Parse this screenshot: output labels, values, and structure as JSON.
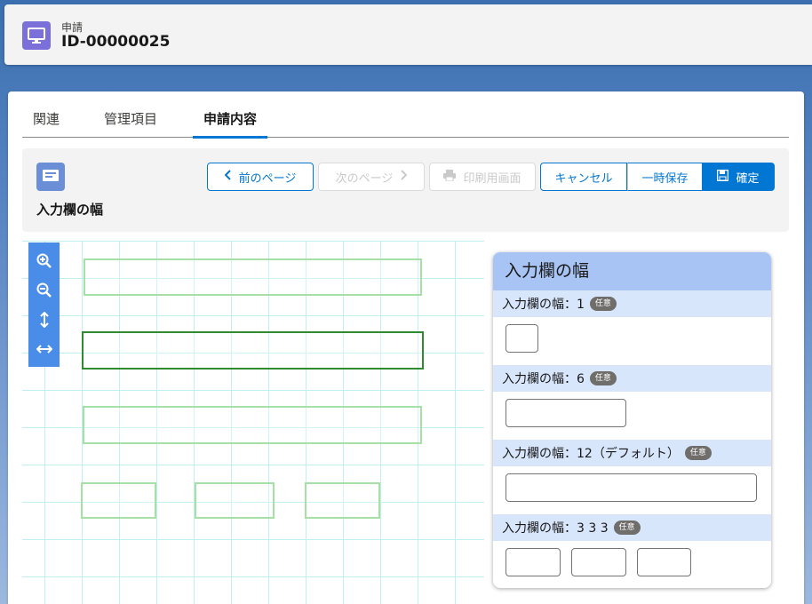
{
  "header": {
    "object_label": "申請",
    "record_id": "ID-00000025"
  },
  "tabs": [
    {
      "label": "関連",
      "active": false
    },
    {
      "label": "管理項目",
      "active": false
    },
    {
      "label": "申請内容",
      "active": true
    }
  ],
  "toolbar": {
    "title": "入力欄の幅",
    "prev_label": "前のページ",
    "next_label": "次のページ",
    "print_label": "印刷用画面",
    "cancel_label": "キャンセル",
    "save_draft_label": "一時保存",
    "confirm_label": "確定"
  },
  "preview": {
    "title": "入力欄の幅",
    "fields": [
      {
        "label": "入力欄の幅：1",
        "badge": "任意"
      },
      {
        "label": "入力欄の幅：6",
        "badge": "任意"
      },
      {
        "label": "入力欄の幅：12（デフォルト）",
        "badge": "任意"
      },
      {
        "label": "入力欄の幅：3 3 3",
        "badge": "任意"
      }
    ]
  },
  "colors": {
    "brand": "#0176d3",
    "header_icon": "#7b6fd9",
    "preview_header": "#a8c4f4",
    "field_label_bg": "#d8e6fb"
  },
  "icons": [
    "desktop-icon",
    "form-icon",
    "chevron-left-icon",
    "chevron-right-icon",
    "printer-icon",
    "save-icon",
    "zoom-in-icon",
    "zoom-out-icon",
    "vertical-resize-icon",
    "horizontal-resize-icon"
  ]
}
